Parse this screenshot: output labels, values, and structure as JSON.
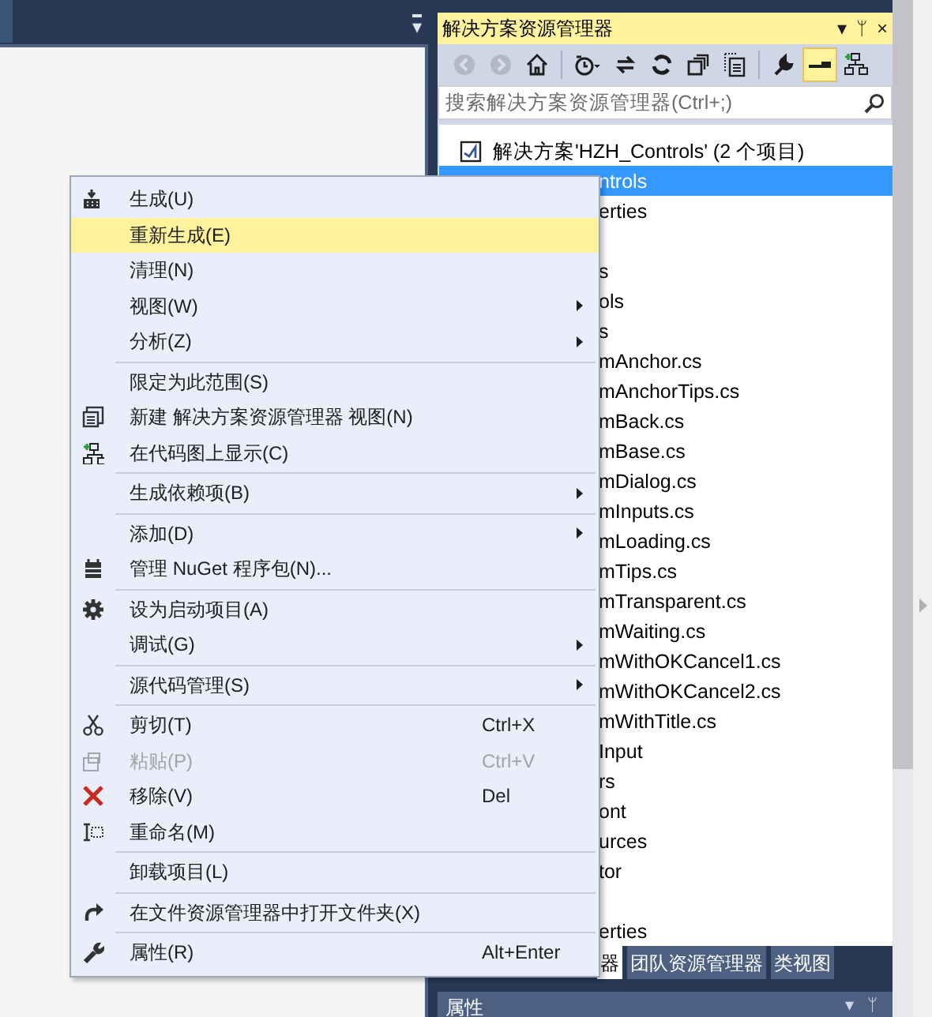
{
  "editor": {
    "tab_menu": "▾"
  },
  "solution_explorer": {
    "title": "解决方案资源管理器",
    "title_buttons": [
      "▾",
      "ᛘ",
      "×"
    ],
    "toolbar": [
      {
        "disabled": true,
        "selected": false
      },
      {
        "disabled": true,
        "selected": false
      },
      {
        "disabled": false,
        "selected": false
      },
      {
        "disabled": false,
        "selected": false
      },
      {
        "disabled": false,
        "selected": false
      },
      {
        "disabled": false,
        "selected": false
      },
      {
        "disabled": false,
        "selected": false
      },
      {
        "disabled": false,
        "selected": false
      },
      {
        "disabled": false,
        "selected": false
      },
      {
        "disabled": false,
        "selected": true
      },
      {
        "disabled": false,
        "selected": false
      }
    ],
    "search": {
      "placeholder": "搜索解决方案资源管理器(Ctrl+;)"
    },
    "tree": [
      {
        "kind": "solution",
        "text": "解决方案'HZH_Controls' (2 个项目)",
        "selected": false
      },
      {
        "kind": "partial",
        "text": "ntrols",
        "selected": true
      },
      {
        "kind": "partial",
        "text": "erties",
        "selected": false
      },
      {
        "kind": "partial",
        "selected": false
      },
      {
        "kind": "partial",
        "text": "s",
        "selected": false
      },
      {
        "kind": "partial",
        "text": "ols",
        "selected": false
      },
      {
        "kind": "partial",
        "text": "s",
        "selected": false
      },
      {
        "kind": "partial",
        "text": "mAnchor.cs",
        "selected": false
      },
      {
        "kind": "partial",
        "text": "mAnchorTips.cs",
        "selected": false
      },
      {
        "kind": "partial",
        "text": "mBack.cs",
        "selected": false
      },
      {
        "kind": "partial",
        "text": "mBase.cs",
        "selected": false
      },
      {
        "kind": "partial",
        "text": "mDialog.cs",
        "selected": false
      },
      {
        "kind": "partial",
        "text": "mInputs.cs",
        "selected": false
      },
      {
        "kind": "partial",
        "text": "mLoading.cs",
        "selected": false
      },
      {
        "kind": "partial",
        "text": "mTips.cs",
        "selected": false
      },
      {
        "kind": "partial",
        "text": "mTransparent.cs",
        "selected": false
      },
      {
        "kind": "partial",
        "text": "mWaiting.cs",
        "selected": false
      },
      {
        "kind": "partial",
        "text": "mWithOKCancel1.cs",
        "selected": false
      },
      {
        "kind": "partial",
        "text": "mWithOKCancel2.cs",
        "selected": false
      },
      {
        "kind": "partial",
        "text": "mWithTitle.cs",
        "selected": false
      },
      {
        "kind": "partial",
        "text": "Input",
        "selected": false
      },
      {
        "kind": "partial",
        "text": "rs",
        "selected": false
      },
      {
        "kind": "partial",
        "text": "ont",
        "selected": false
      },
      {
        "kind": "partial",
        "text": "urces",
        "selected": false
      },
      {
        "kind": "partial",
        "text": "tor",
        "selected": false
      },
      {
        "kind": "partial",
        "selected": false
      },
      {
        "kind": "partial",
        "text": "erties",
        "selected": false
      }
    ],
    "tabs": [
      {
        "label": "器",
        "selected": true
      },
      {
        "label": "团队资源管理器",
        "selected": false
      },
      {
        "label": "类视图",
        "selected": false
      }
    ]
  },
  "properties_panel": {
    "title": "属性",
    "title_buttons": [
      "▾",
      "ᛘ"
    ]
  },
  "context_menu": [
    {
      "kind": "item",
      "label": "生成(U)",
      "selected": false,
      "disabled": false,
      "submenu": false
    },
    {
      "kind": "item",
      "label": "重新生成(E)",
      "selected": true,
      "disabled": false,
      "submenu": false
    },
    {
      "kind": "item",
      "label": "清理(N)",
      "selected": false,
      "disabled": false,
      "submenu": false
    },
    {
      "kind": "item",
      "label": "视图(W)",
      "selected": false,
      "disabled": false,
      "submenu": true
    },
    {
      "kind": "item",
      "label": "分析(Z)",
      "selected": false,
      "disabled": false,
      "submenu": true
    },
    {
      "kind": "separator"
    },
    {
      "kind": "item",
      "label": "限定为此范围(S)",
      "selected": false,
      "disabled": false,
      "submenu": false
    },
    {
      "kind": "item",
      "label": "新建 解决方案资源管理器 视图(N)",
      "selected": false,
      "disabled": false,
      "submenu": false
    },
    {
      "kind": "item",
      "label": "在代码图上显示(C)",
      "selected": false,
      "disabled": false,
      "submenu": false
    },
    {
      "kind": "separator"
    },
    {
      "kind": "item",
      "label": "生成依赖项(B)",
      "selected": false,
      "disabled": false,
      "submenu": true
    },
    {
      "kind": "separator"
    },
    {
      "kind": "item",
      "label": "添加(D)",
      "selected": false,
      "disabled": false,
      "submenu": true
    },
    {
      "kind": "item",
      "label": "管理 NuGet 程序包(N)...",
      "selected": false,
      "disabled": false,
      "submenu": false
    },
    {
      "kind": "separator"
    },
    {
      "kind": "item",
      "label": "设为启动项目(A)",
      "selected": false,
      "disabled": false,
      "submenu": false
    },
    {
      "kind": "item",
      "label": "调试(G)",
      "selected": false,
      "disabled": false,
      "submenu": true
    },
    {
      "kind": "separator"
    },
    {
      "kind": "item",
      "label": "源代码管理(S)",
      "selected": false,
      "disabled": false,
      "submenu": true
    },
    {
      "kind": "separator"
    },
    {
      "kind": "item",
      "label": "剪切(T)",
      "shortcut": "Ctrl+X",
      "selected": false,
      "disabled": false,
      "submenu": false
    },
    {
      "kind": "item",
      "label": "粘贴(P)",
      "shortcut": "Ctrl+V",
      "selected": false,
      "disabled": true,
      "submenu": false
    },
    {
      "kind": "item",
      "label": "移除(V)",
      "shortcut": "Del",
      "selected": false,
      "disabled": false,
      "submenu": false
    },
    {
      "kind": "item",
      "label": "重命名(M)",
      "selected": false,
      "disabled": false,
      "submenu": false
    },
    {
      "kind": "separator"
    },
    {
      "kind": "item",
      "label": "卸载项目(L)",
      "selected": false,
      "disabled": false,
      "submenu": false
    },
    {
      "kind": "separator"
    },
    {
      "kind": "item",
      "label": "在文件资源管理器中打开文件夹(X)",
      "selected": false,
      "disabled": false,
      "submenu": false
    },
    {
      "kind": "separator"
    },
    {
      "kind": "item",
      "label": "属性(R)",
      "shortcut": "Alt+Enter",
      "selected": false,
      "disabled": false,
      "submenu": false
    }
  ]
}
